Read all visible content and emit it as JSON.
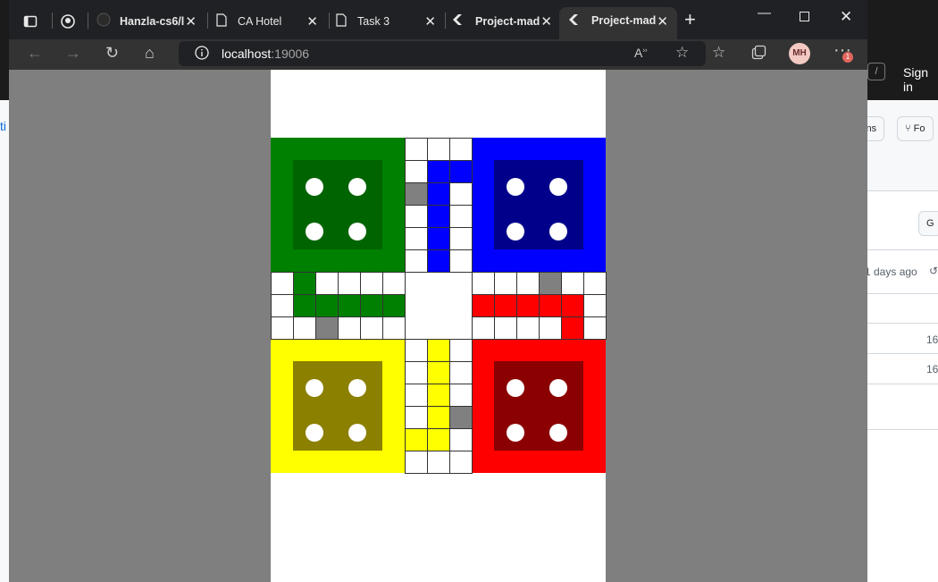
{
  "browser": {
    "tabs": [
      {
        "title": "Hanzla-cs6/l",
        "icon": "github-icon"
      },
      {
        "title": "CA Hotel",
        "icon": "page-icon"
      },
      {
        "title": "Task 3",
        "icon": "page-icon"
      },
      {
        "title": "Project-mad",
        "icon": "flutter-icon"
      },
      {
        "title": "Project-mad",
        "icon": "flutter-icon",
        "active": true
      }
    ],
    "url_host": "localhost",
    "url_port": ":19006",
    "read_aloud_label": "A",
    "profile_initials": "MH",
    "notification_count": "1"
  },
  "background_page": {
    "sign_in": "Sign in",
    "slash_key": "/",
    "button_ions": "ions",
    "button_fork": "Fo",
    "button_g": "G",
    "link_fragment": "ti",
    "days_ago": "1 days ago",
    "row1_value": "16",
    "row2_value": "16"
  },
  "ludo": {
    "colors": {
      "green": "#008000",
      "green_dark": "#006400",
      "blue": "#0000ff",
      "blue_dark": "#00008b",
      "yellow": "#ffff00",
      "yellow_dark": "#8b8000",
      "red": "#ff0000",
      "red_dark": "#8b0000",
      "safe": "#808080",
      "cell": "#ffffff"
    }
  }
}
